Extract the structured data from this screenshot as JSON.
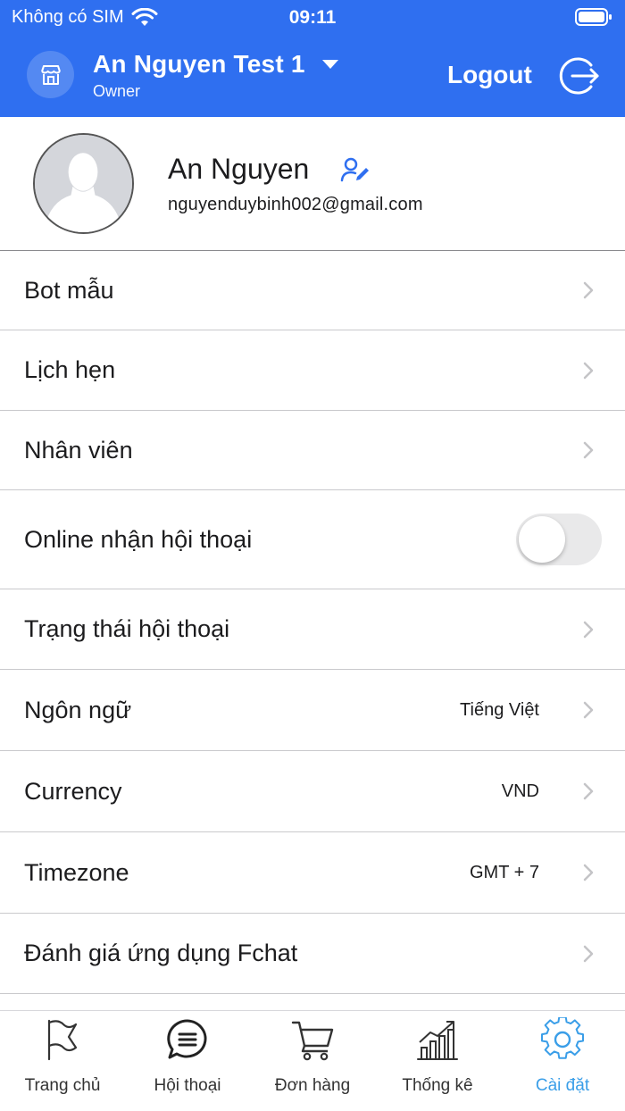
{
  "status_bar": {
    "carrier": "Không có SIM",
    "time": "09:11"
  },
  "header": {
    "shop_name": "An Nguyen Test 1",
    "role": "Owner",
    "logout_label": "Logout",
    "background_color": "#2f6ff0"
  },
  "profile": {
    "name": "An Nguyen",
    "email": "nguyenduybinh002@gmail.com"
  },
  "menu": {
    "items": [
      {
        "label": "Bot mẫu"
      },
      {
        "label": "Lịch hẹn"
      },
      {
        "label": "Nhân viên"
      },
      {
        "label": "Online nhận hội thoại",
        "toggle_on": false
      },
      {
        "label": "Trạng thái hội thoại"
      },
      {
        "label": "Ngôn ngữ",
        "value": "Tiếng Việt"
      },
      {
        "label": "Currency",
        "value": "VND"
      },
      {
        "label": "Timezone",
        "value": "GMT + 7"
      },
      {
        "label": "Đánh giá ứng dụng Fchat"
      }
    ]
  },
  "tabbar": {
    "tabs": [
      {
        "label": "Trang chủ",
        "icon": "flag-icon"
      },
      {
        "label": "Hội thoại",
        "icon": "chat-bubble-icon"
      },
      {
        "label": "Đơn hàng",
        "icon": "cart-icon"
      },
      {
        "label": "Thống kê",
        "icon": "chart-icon"
      },
      {
        "label": "Cài đặt",
        "icon": "gear-icon",
        "active": true
      }
    ],
    "active_color": "#3a9ee8"
  }
}
